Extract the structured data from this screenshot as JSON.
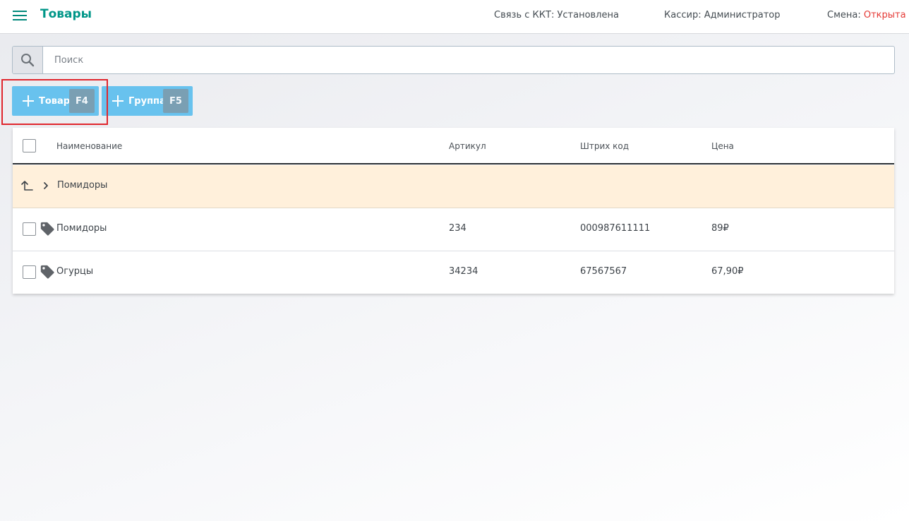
{
  "header": {
    "title": "Товары",
    "kkt_label": "Связь с ККТ: Установлена",
    "cashier_label": "Кассир: Администратор",
    "shift_label": "Смена: ",
    "shift_value": "Открыта",
    "shift_color": "#e53935",
    "accent_color": "#009688"
  },
  "search": {
    "placeholder": "Поиск",
    "icon": "search-icon"
  },
  "toolbar": {
    "add_product_label": "Товар",
    "add_product_key": "F4",
    "add_group_label": "Группа",
    "add_group_key": "F5",
    "button_color": "#68c2ee"
  },
  "table": {
    "columns": [
      "Наименование",
      "Артикул",
      "Штрих код",
      "Цена"
    ],
    "group_row": {
      "name": "Помидоры",
      "icons": [
        "level-up-icon",
        "chevron-right-icon"
      ]
    },
    "rows": [
      {
        "name": "Помидоры",
        "sku": "234",
        "barcode": "000987611111",
        "price": "89₽",
        "icon": "tag-icon"
      },
      {
        "name": "Огурцы",
        "sku": "34234",
        "barcode": "67567567",
        "price": "67,90₽",
        "icon": "tag-icon"
      }
    ]
  }
}
